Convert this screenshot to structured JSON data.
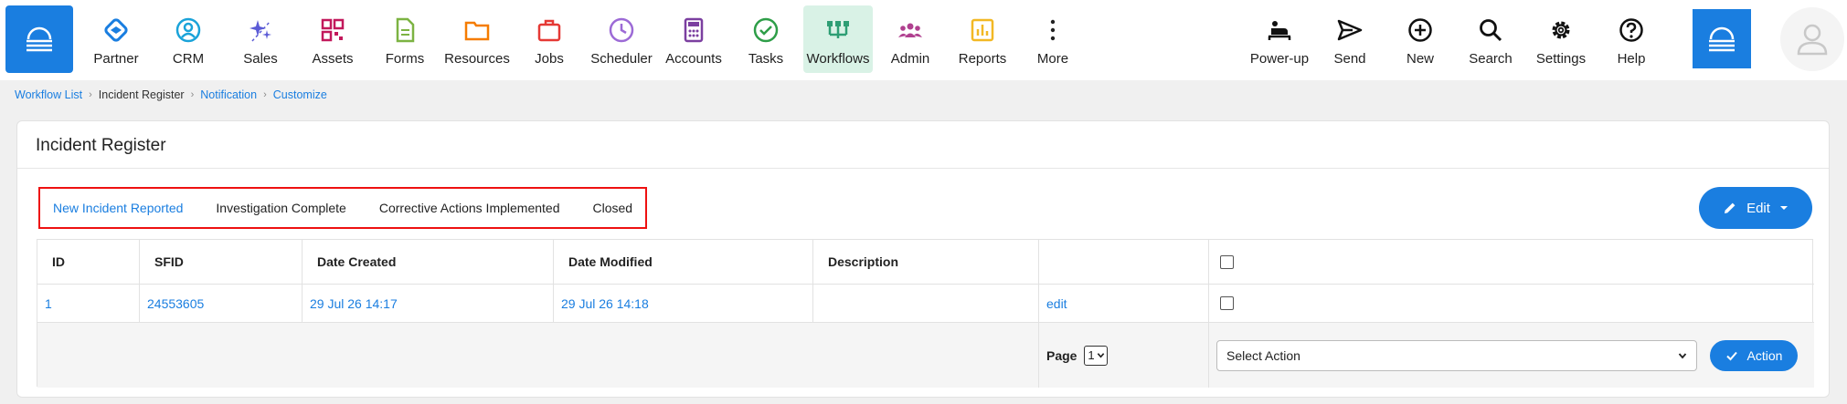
{
  "nav": {
    "items": [
      {
        "label": "Partner",
        "icon": "handshake-icon",
        "color": "#1a7ee0"
      },
      {
        "label": "CRM",
        "icon": "user-circle-icon",
        "color": "#1aa3d9"
      },
      {
        "label": "Sales",
        "icon": "sparkle-icon",
        "color": "#5b5bd6"
      },
      {
        "label": "Assets",
        "icon": "qr-grid-icon",
        "color": "#c2185b"
      },
      {
        "label": "Forms",
        "icon": "document-icon",
        "color": "#7cb342"
      },
      {
        "label": "Resources",
        "icon": "folder-icon",
        "color": "#f57c00"
      },
      {
        "label": "Jobs",
        "icon": "briefcase-icon",
        "color": "#e53935"
      },
      {
        "label": "Scheduler",
        "icon": "clock-icon",
        "color": "#9c6ad6"
      },
      {
        "label": "Accounts",
        "icon": "calculator-icon",
        "color": "#7b3fa0"
      },
      {
        "label": "Tasks",
        "icon": "check-circle-icon",
        "color": "#2e9e48"
      },
      {
        "label": "Workflows",
        "icon": "workflow-icon",
        "color": "#2e9e74",
        "active": true
      },
      {
        "label": "Admin",
        "icon": "people-icon",
        "color": "#b0408f"
      },
      {
        "label": "Reports",
        "icon": "bar-chart-icon",
        "color": "#f2b824"
      },
      {
        "label": "More",
        "icon": "more-vertical-icon",
        "color": "#222222"
      }
    ],
    "right_items": [
      {
        "label": "Power-up",
        "icon": "bed-icon"
      },
      {
        "label": "Send",
        "icon": "send-icon"
      },
      {
        "label": "New",
        "icon": "plus-circle-icon"
      },
      {
        "label": "Search",
        "icon": "search-icon"
      },
      {
        "label": "Settings",
        "icon": "gear-icon"
      },
      {
        "label": "Help",
        "icon": "help-circle-icon"
      }
    ]
  },
  "breadcrumb": [
    {
      "label": "Workflow List",
      "link": true
    },
    {
      "label": "Incident Register",
      "link": false
    },
    {
      "label": "Notification",
      "link": true
    },
    {
      "label": "Customize",
      "link": true
    }
  ],
  "card": {
    "title": "Incident Register",
    "tabs": [
      {
        "label": "New Incident Reported",
        "active": true
      },
      {
        "label": "Investigation Complete",
        "active": false
      },
      {
        "label": "Corrective Actions Implemented",
        "active": false
      },
      {
        "label": "Closed",
        "active": false
      }
    ],
    "edit_label": "Edit"
  },
  "table": {
    "headers": [
      "ID",
      "SFID",
      "Date Created",
      "Date Modified",
      "Description",
      ""
    ],
    "rows": [
      {
        "id": "1",
        "sfid": "24553605",
        "created": "29 Jul 26 14:17",
        "modified": "29 Jul 26 14:18",
        "description": "",
        "edit": "edit"
      }
    ],
    "footer": {
      "page_label": "Page",
      "page_value": "1",
      "action_select": "Select Action",
      "action_button": "Action"
    }
  },
  "colors": {
    "accent": "#1a7ee0",
    "highlight_border": "#ee1111",
    "active_nav_bg": "#d9f2e6"
  }
}
